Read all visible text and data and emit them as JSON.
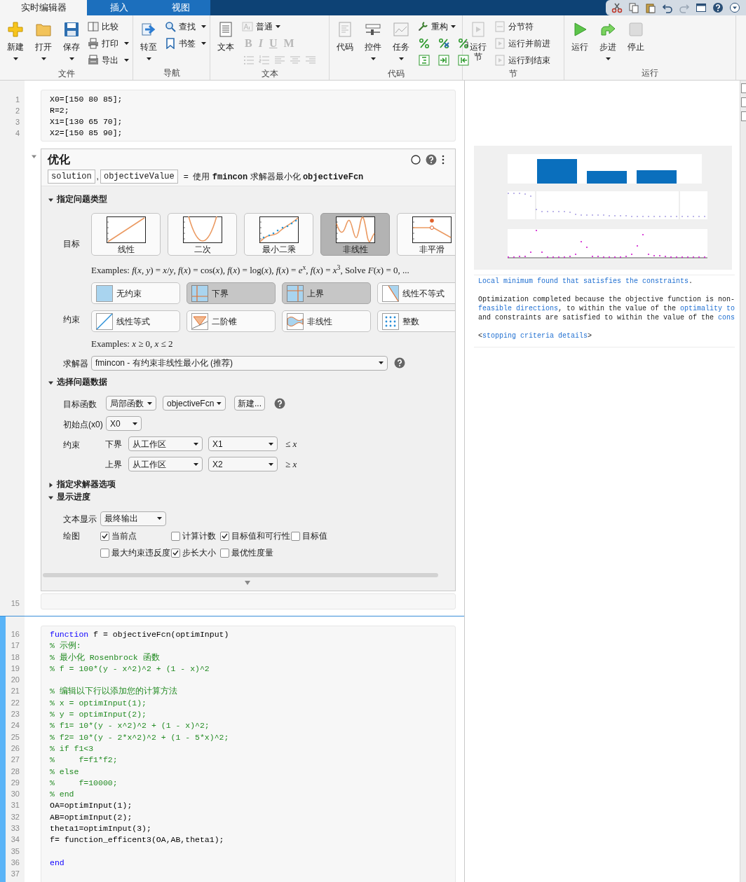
{
  "ribbon_tabs": [
    {
      "label": "实时编辑器",
      "selected": true
    },
    {
      "label": "插入",
      "selected": false
    },
    {
      "label": "视图",
      "selected": false
    }
  ],
  "toolbar_groups": [
    {
      "label": "文件",
      "items": [
        {
          "kind": "large",
          "label": "新建",
          "caret": true
        },
        {
          "kind": "large",
          "label": "打开",
          "caret": true
        },
        {
          "kind": "large",
          "label": "保存",
          "caret": true
        },
        {
          "kind": "stack",
          "entries": [
            {
              "label": "比较",
              "caret": false
            },
            {
              "label": "打印",
              "caret": true
            },
            {
              "label": "导出",
              "caret": true
            }
          ]
        }
      ]
    },
    {
      "label": "导航",
      "items": [
        {
          "kind": "large",
          "label": "转至",
          "caret": true
        },
        {
          "kind": "stack",
          "entries": [
            {
              "label": "查找",
              "caret": true
            },
            {
              "label": "书签",
              "caret": true
            }
          ]
        }
      ]
    },
    {
      "label": "文本",
      "items": [
        {
          "kind": "large",
          "label": "文本",
          "caret": false
        },
        {
          "kind": "format",
          "style": "普通",
          "marks": [
            {
              "label": "B",
              "disabled": true
            },
            {
              "label": "I",
              "disabled": true
            },
            {
              "label": "U",
              "disabled": true
            },
            {
              "label": "M",
              "disabled": true
            }
          ]
        }
      ]
    },
    {
      "label": "代码",
      "items": [
        {
          "kind": "large",
          "label": "代码",
          "caret": false
        },
        {
          "kind": "large",
          "label": "控件",
          "caret": true
        },
        {
          "kind": "large",
          "label": "任务",
          "caret": true
        },
        {
          "kind": "tools",
          "label": "重构",
          "caret": true
        }
      ]
    },
    {
      "label": "节",
      "items": [
        {
          "kind": "large",
          "label": "运行节",
          "caret": false
        },
        {
          "kind": "stack",
          "entries": [
            {
              "label": "分节符",
              "caret": false
            },
            {
              "label": "运行并前进",
              "caret": false
            },
            {
              "label": "运行到结束",
              "caret": false
            }
          ]
        }
      ]
    },
    {
      "label": "运行",
      "items": [
        {
          "kind": "large",
          "label": "运行",
          "caret": false
        },
        {
          "kind": "large",
          "label": "步进",
          "caret": true
        },
        {
          "kind": "large",
          "label": "停止",
          "caret": false
        }
      ]
    }
  ],
  "section_1": {
    "code_lines": [
      {
        "number": "1",
        "segments": [
          {
            "text": "X0=[150 80 85];",
            "kind": "plain"
          }
        ]
      },
      {
        "number": "2",
        "segments": [
          {
            "text": "R=2;",
            "kind": "plain"
          }
        ]
      },
      {
        "number": "3",
        "segments": [
          {
            "text": "X1=[130 65 70];",
            "kind": "plain"
          }
        ]
      },
      {
        "number": "4",
        "segments": [
          {
            "text": "X2=[150 85 90];",
            "kind": "plain"
          }
        ]
      }
    ],
    "task": {
      "title": "优化",
      "outputs": [
        "solution",
        "objectiveValue"
      ],
      "separator": ",",
      "summary": "=  使用 **fmincon** 求解器最小化 **objectiveFcn**",
      "problem_type": {
        "heading": "指定问题类型",
        "expanded": true,
        "objective_label": "目标",
        "objectives": [
          {
            "label": "线性",
            "kind": "linear",
            "selected": false
          },
          {
            "label": "二次",
            "kind": "quadratic",
            "selected": false
          },
          {
            "label": "最小二乘",
            "kind": "least_squares",
            "selected": false
          },
          {
            "label": "非线性",
            "kind": "nonlinear",
            "selected": true
          },
          {
            "label": "非平滑",
            "kind": "nonsmooth",
            "selected": false
          }
        ],
        "objective_examples": "Examples: *f*(*x*, *y*) = *x*/*y*, *f*(*x*) = cos(*x*), *f*(*x*) = log(*x*), *f*(*x*) = *e*$^{x}$, *f*(*x*) = *x*$^{3}$, Solve *F*(*x*) = 0, ...",
        "constraint_label": "约束",
        "constraints": [
          {
            "label": "无约束",
            "kind": "none",
            "selected": false
          },
          {
            "label": "下界",
            "kind": "lower",
            "selected": true
          },
          {
            "label": "上界",
            "kind": "upper",
            "selected": true
          },
          {
            "label": "线性不等式",
            "kind": "linear_inequality",
            "selected": false
          },
          {
            "label": "线性等式",
            "kind": "linear_equality",
            "selected": false
          },
          {
            "label": "二阶锥",
            "kind": "cone",
            "selected": false
          },
          {
            "label": "非线性",
            "kind": "nonlinear",
            "selected": false
          },
          {
            "label": "整数",
            "kind": "integer",
            "selected": false
          }
        ],
        "constraint_examples": "Examples: *x* ≥ 0, *x* ≤ 2",
        "solver_label": "求解器",
        "solver": "fmincon - 有约束非线性最小化 (推荐)"
      },
      "problem_data": {
        "heading": "选择问题数据",
        "expanded": true,
        "objective_label": "目标函数",
        "objective_source": "局部函数",
        "objective_function": "objectiveFcn",
        "new_button": "新建...",
        "initial_point_label": "初始点(x0)",
        "initial_point": "X0",
        "constraints_label": "约束",
        "bounds": [
          {
            "label": "下界",
            "source": "从工作区",
            "variable": "X1",
            "relation": "≤ *x*"
          },
          {
            "label": "上界",
            "source": "从工作区",
            "variable": "X2",
            "relation": "≥ *x*"
          }
        ]
      },
      "solver_options": {
        "heading": "指定求解器选项",
        "expanded": false
      },
      "display": {
        "heading": "显示进度",
        "expanded": true,
        "text_label": "文本显示",
        "text_display": "最终输出",
        "plot_label": "绘图",
        "plots": [
          {
            "label": "当前点",
            "checked": true
          },
          {
            "label": "计算计数",
            "checked": false
          },
          {
            "label": "目标值和可行性",
            "checked": true
          },
          {
            "label": "目标值",
            "checked": false
          },
          {
            "label": "最大约束违反度",
            "checked": false
          },
          {
            "label": "步长大小",
            "checked": true
          },
          {
            "label": "最优性度量",
            "checked": false
          }
        ]
      }
    },
    "trailing_lines": [
      {
        "number": "15"
      }
    ]
  },
  "section_2": {
    "code_lines": [
      {
        "number": "16",
        "segments": [
          {
            "text": "function",
            "kind": "keyword"
          },
          {
            "text": " f = objectiveFcn(optimInput)",
            "kind": "plain"
          }
        ]
      },
      {
        "number": "17",
        "segments": [
          {
            "text": "% 示例:",
            "kind": "comment"
          }
        ]
      },
      {
        "number": "18",
        "segments": [
          {
            "text": "% 最小化 Rosenbrock 函数",
            "kind": "comment"
          }
        ]
      },
      {
        "number": "19",
        "segments": [
          {
            "text": "% f = 100*(y - x^2)^2 + (1 - x)^2",
            "kind": "comment"
          }
        ]
      },
      {
        "number": "20"
      },
      {
        "number": "21",
        "segments": [
          {
            "text": "% 编辑以下行以添加您的计算方法",
            "kind": "comment"
          }
        ]
      },
      {
        "number": "22",
        "segments": [
          {
            "text": "% x = optimInput(1);",
            "kind": "comment"
          }
        ]
      },
      {
        "number": "23",
        "segments": [
          {
            "text": "% y = optimInput(2);",
            "kind": "comment"
          }
        ]
      },
      {
        "number": "24",
        "segments": [
          {
            "text": "% f1= 10*(y - x^2)^2 + (1 - x)^2;",
            "kind": "comment"
          }
        ]
      },
      {
        "number": "25",
        "segments": [
          {
            "text": "% f2= 10*(y - 2*x^2)^2 + (1 - 5*x)^2;",
            "kind": "comment"
          }
        ]
      },
      {
        "number": "26",
        "segments": [
          {
            "text": "% if f1<3",
            "kind": "comment"
          }
        ]
      },
      {
        "number": "27",
        "segments": [
          {
            "text": "%     f=f1*f2;",
            "kind": "comment"
          }
        ]
      },
      {
        "number": "28",
        "segments": [
          {
            "text": "% else",
            "kind": "comment"
          }
        ]
      },
      {
        "number": "29",
        "segments": [
          {
            "text": "%     f=10000;",
            "kind": "comment"
          }
        ]
      },
      {
        "number": "30",
        "segments": [
          {
            "text": "% end",
            "kind": "comment"
          }
        ]
      },
      {
        "number": "31",
        "segments": [
          {
            "text": "OA=optimInput(1);",
            "kind": "plain"
          }
        ]
      },
      {
        "number": "32",
        "segments": [
          {
            "text": "AB=optimInput(2);",
            "kind": "plain"
          }
        ]
      },
      {
        "number": "33",
        "segments": [
          {
            "text": "theta1=optimInput(3);",
            "kind": "plain"
          }
        ]
      },
      {
        "number": "34",
        "segments": [
          {
            "text": "f= function_efficent3(OA,AB,theta1);",
            "kind": "plain"
          }
        ]
      },
      {
        "number": "35"
      },
      {
        "number": "36",
        "segments": [
          {
            "text": "end",
            "kind": "keyword"
          }
        ]
      },
      {
        "number": "37"
      }
    ]
  },
  "output": {
    "messages": [
      {
        "lines": [
          [
            {
              "text": "Local minimum found that satisfies the constraints",
              "link": true
            },
            {
              "text": ".",
              "link": false
            }
          ]
        ]
      },
      {
        "lines": [
          [
            {
              "text": "Optimization completed because the objective function is non-",
              "link": false
            }
          ],
          [
            {
              "text": "feasible directions",
              "link": true
            },
            {
              "text": ", to within the value of the ",
              "link": false
            },
            {
              "text": "optimality to",
              "link": true
            }
          ],
          [
            {
              "text": "and constraints are satisfied to within the value of the ",
              "link": false
            },
            {
              "text": "cons",
              "link": true
            }
          ]
        ]
      },
      {
        "lines": [
          [
            {
              "text": "<",
              "link": false
            },
            {
              "text": "stopping criteria details",
              "link": true
            },
            {
              "text": ">",
              "link": false
            }
          ]
        ]
      }
    ]
  }
}
